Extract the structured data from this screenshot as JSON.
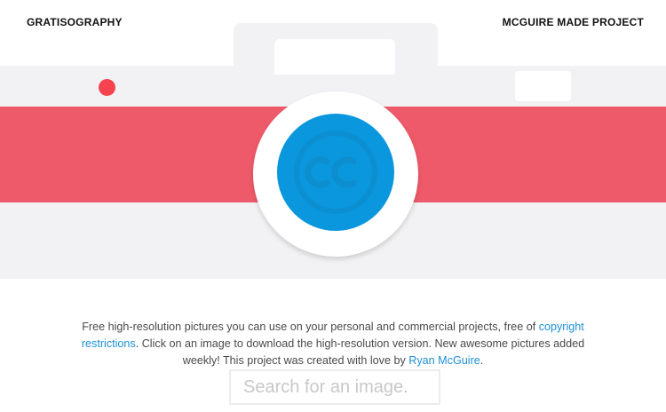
{
  "header": {
    "brand": "GRATISOGRAPHY",
    "project_link": "MCGUIRE MADE PROJECT"
  },
  "hero": {
    "icons": [
      "camera-illustration",
      "creative-commons-icon"
    ],
    "colors": {
      "stripe": "#ef5a6a",
      "lens": "#0a97dd",
      "record_dot": "#f5434f",
      "body": "#f2f2f4"
    }
  },
  "description": {
    "part1": "Free high-resolution pictures you can use on your personal and commercial projects, free of ",
    "link1": "copyright restrictions",
    "part2": ". Click on an image to download the high-resolution version. New awesome pictures added weekly! This project was created with love by ",
    "link2": "Ryan McGuire",
    "part3": "."
  },
  "search": {
    "placeholder": "Search for an image."
  }
}
